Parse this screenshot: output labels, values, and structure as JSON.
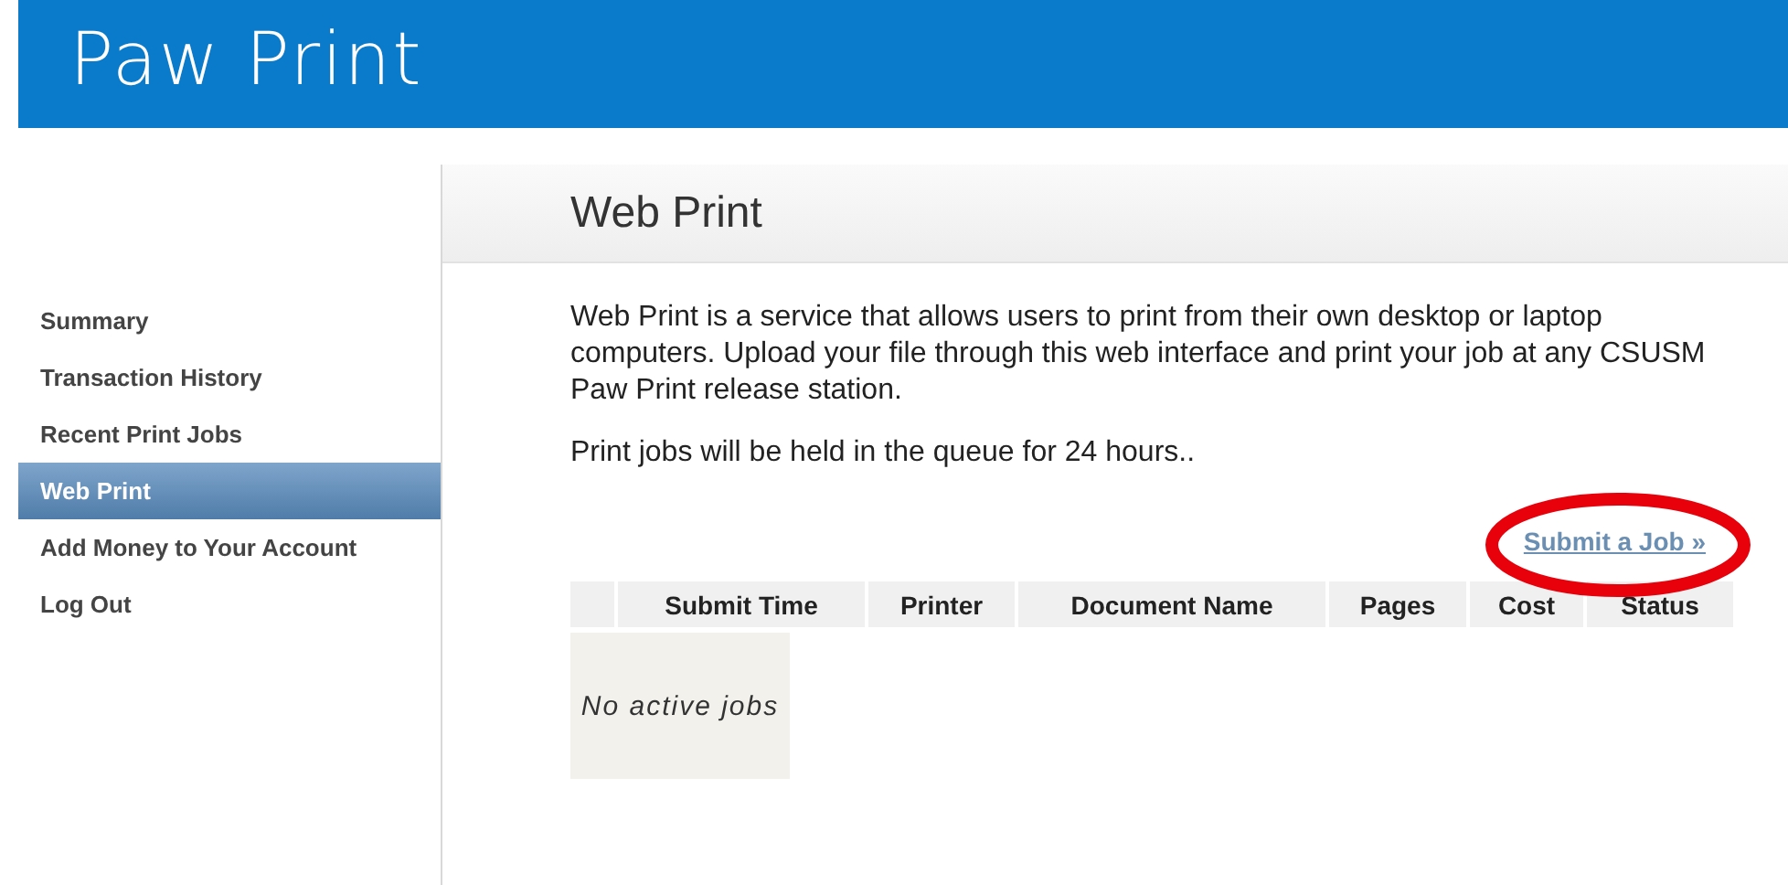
{
  "logo": {
    "text": "Paw Print"
  },
  "sidebar": {
    "items": [
      {
        "label": "Summary",
        "selected": false
      },
      {
        "label": "Transaction History",
        "selected": false
      },
      {
        "label": "Recent Print Jobs",
        "selected": false
      },
      {
        "label": "Web Print",
        "selected": true
      },
      {
        "label": "Add Money to Your Account",
        "selected": false
      },
      {
        "label": "Log Out",
        "selected": false
      }
    ]
  },
  "page": {
    "title": "Web Print",
    "paragraphs": [
      "Web Print is a service that allows users to print from their own desktop or laptop computers. Upload your file through this web interface and print your job at any CSUSM Paw Print release station.",
      "Print jobs will be held in the queue for 24 hours.."
    ],
    "submit_link": {
      "label": "Submit a Job »",
      "circled": true
    }
  },
  "table": {
    "columns": [
      "Submit Time",
      "Printer",
      "Document Name",
      "Pages",
      "Cost",
      "Status"
    ],
    "empty_message": "No active jobs"
  }
}
